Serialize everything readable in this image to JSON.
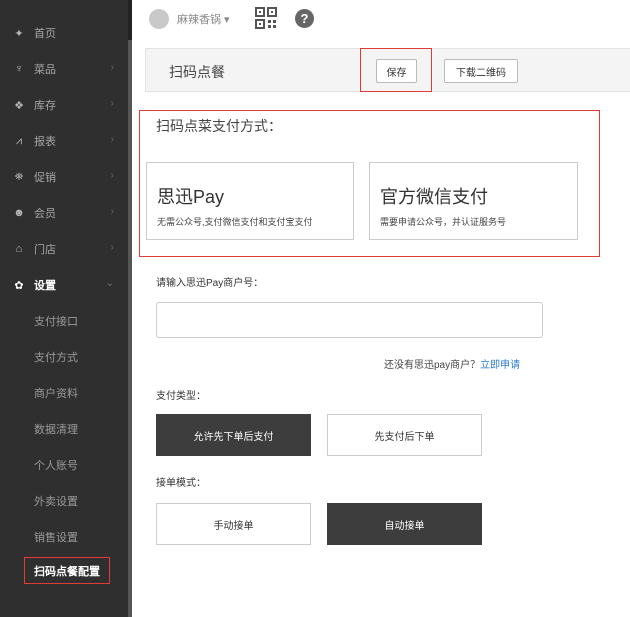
{
  "sidebar": {
    "items": [
      {
        "label": "首页",
        "icon": "home-icon",
        "glyph": "✦"
      },
      {
        "label": "菜品",
        "icon": "utensils-icon",
        "glyph": "♆"
      },
      {
        "label": "库存",
        "icon": "cubes-icon",
        "glyph": "❖"
      },
      {
        "label": "报表",
        "icon": "chart-line-icon",
        "glyph": "⩘"
      },
      {
        "label": "促销",
        "icon": "gift-icon",
        "glyph": "⛯"
      },
      {
        "label": "会员",
        "icon": "users-icon",
        "glyph": "☻"
      },
      {
        "label": "门店",
        "icon": "bank-icon",
        "glyph": "⌂"
      },
      {
        "label": "设置",
        "icon": "gear-icon",
        "glyph": "✿"
      }
    ],
    "sub_items": [
      "支付接口",
      "支付方式",
      "商户资料",
      "数据清理",
      "个人账号",
      "外卖设置",
      "销售设置",
      "扫码点餐配置"
    ]
  },
  "topbar": {
    "shop_name": "麻辣香锅 ▾"
  },
  "toolbar": {
    "title": "扫码点餐",
    "save_label": "保存",
    "download_label": "下载二维码"
  },
  "payment": {
    "heading": "扫码点菜支付方式：",
    "options": [
      {
        "title": "思迅Pay",
        "desc": "无需公众号,支付微信支付和支付宝支付"
      },
      {
        "title": "官方微信支付",
        "desc": "需要申请公众号，并认证服务号"
      }
    ]
  },
  "merchant": {
    "label": "请输入思迅Pay商户号：",
    "value": "",
    "no_account_text": "还没有思迅pay商户？",
    "apply_link": "立即申请"
  },
  "pay_type": {
    "label": "支付类型：",
    "options": [
      "允许先下单后支付",
      "先支付后下单"
    ],
    "selected": "允许先下单后支付"
  },
  "order_mode": {
    "label": "接单模式：",
    "options": [
      "手动接单",
      "自动接单"
    ],
    "selected": "自动接单"
  },
  "colors": {
    "sidebar_bg": "#2f2f2f",
    "highlight_red": "#e53935",
    "selected_option": "#3d3d3d",
    "link_blue": "#2a7ad2"
  }
}
